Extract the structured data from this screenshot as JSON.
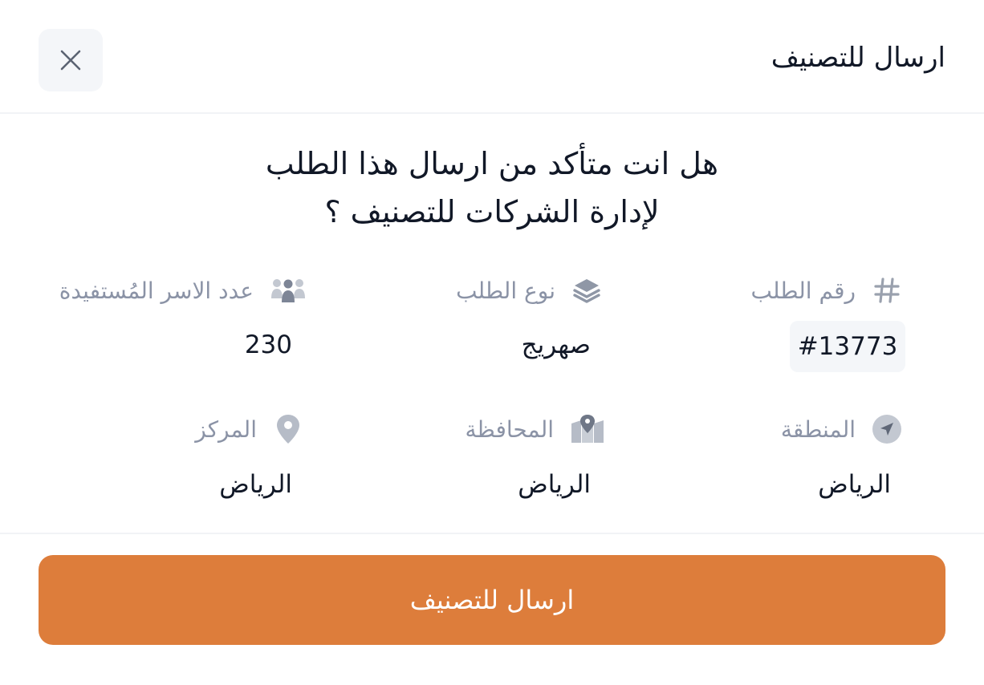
{
  "header": {
    "title": "ارسال للتصنيف"
  },
  "question": {
    "line1": "هل انت متأكد من ارسال هذا الطلب",
    "line2": "لإدارة الشركات للتصنيف ؟"
  },
  "fields": {
    "order_number": {
      "label": "رقم الطلب",
      "value": "#13773",
      "icon": "hash-icon"
    },
    "order_type": {
      "label": "نوع الطلب",
      "value": "صهريج",
      "icon": "layers-icon"
    },
    "families_count": {
      "label": "عدد الاسر المُستفيدة",
      "value": "230",
      "icon": "people-group-icon"
    },
    "region": {
      "label": "المنطقة",
      "value": "الرياض",
      "icon": "navigation-arrow-icon"
    },
    "governorate": {
      "label": "المحافظة",
      "value": "الرياض",
      "icon": "map-icon"
    },
    "center": {
      "label": "المركز",
      "value": "الرياض",
      "icon": "map-pin-icon"
    }
  },
  "footer": {
    "submit_label": "ارسال للتصنيف"
  },
  "colors": {
    "accent": "#dd7d3b",
    "icon_gray": "#9aa1ae",
    "label_gray": "#8b93a6"
  }
}
